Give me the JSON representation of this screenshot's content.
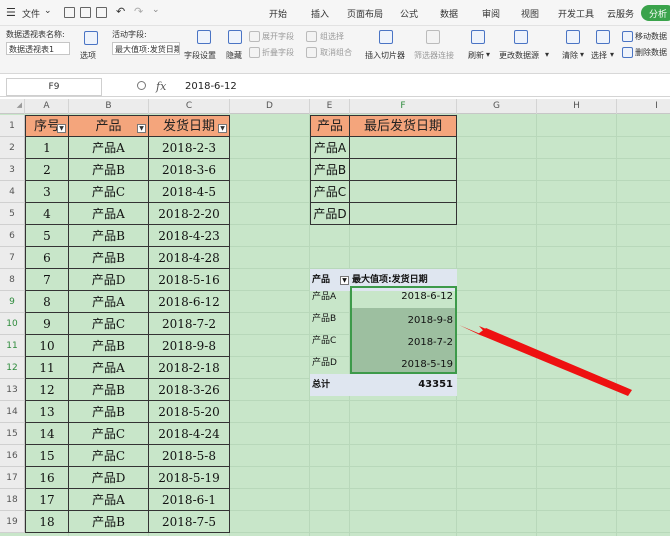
{
  "menubar": {
    "file_label": "文件",
    "tabs": [
      "开始",
      "插入",
      "页面布局",
      "公式",
      "数据",
      "审阅",
      "视图",
      "开发工具",
      "云服务"
    ],
    "pill_label": "分析"
  },
  "ribbon": {
    "pivot_name_label": "数据透视表名称:",
    "pivot_name_value": "数据透视表1",
    "options_label": "选项",
    "active_field_label": "活动字段:",
    "active_field_value": "最大值项:发货日期",
    "field_settings_label": "字段设置",
    "hide_label": "隐藏",
    "expand_label": "展开字段",
    "collapse_label": "折叠字段",
    "group_sel_label": "组选择",
    "ungroup_label": "取消组合",
    "insert_slicer_label": "插入切片器",
    "filter_conn_label": "筛选器连接",
    "refresh_label": "刷新",
    "change_source_label": "更改数据源",
    "clear_label": "清除",
    "select_label": "选择",
    "move_pivot_label": "移动数据",
    "delete_pivot_label": "删除数据"
  },
  "formula_bar": {
    "cell_ref": "F9",
    "fx": "fx",
    "value": "2018-6-12"
  },
  "columns": [
    "A",
    "B",
    "C",
    "D",
    "E",
    "F",
    "G",
    "H",
    "I"
  ],
  "rows": [
    "1",
    "2",
    "3",
    "4",
    "5",
    "6",
    "7",
    "8",
    "9",
    "10",
    "11",
    "12",
    "13",
    "14",
    "15",
    "16",
    "17",
    "18",
    "19"
  ],
  "main_table": {
    "headers": [
      "序号",
      "产品",
      "发货日期"
    ],
    "data": [
      [
        "1",
        "产品A",
        "2018-2-3"
      ],
      [
        "2",
        "产品B",
        "2018-3-6"
      ],
      [
        "3",
        "产品C",
        "2018-4-5"
      ],
      [
        "4",
        "产品A",
        "2018-2-20"
      ],
      [
        "5",
        "产品B",
        "2018-4-23"
      ],
      [
        "6",
        "产品B",
        "2018-4-28"
      ],
      [
        "7",
        "产品D",
        "2018-5-16"
      ],
      [
        "8",
        "产品A",
        "2018-6-12"
      ],
      [
        "9",
        "产品C",
        "2018-7-2"
      ],
      [
        "10",
        "产品B",
        "2018-9-8"
      ],
      [
        "11",
        "产品A",
        "2018-2-18"
      ],
      [
        "12",
        "产品B",
        "2018-3-26"
      ],
      [
        "13",
        "产品B",
        "2018-5-20"
      ],
      [
        "14",
        "产品C",
        "2018-4-24"
      ],
      [
        "15",
        "产品C",
        "2018-5-8"
      ],
      [
        "16",
        "产品D",
        "2018-5-19"
      ],
      [
        "17",
        "产品A",
        "2018-6-1"
      ],
      [
        "18",
        "产品B",
        "2018-7-5"
      ]
    ]
  },
  "summary_table": {
    "headers": [
      "产品",
      "最后发货日期"
    ],
    "products": [
      "产品A",
      "产品B",
      "产品C",
      "产品D"
    ]
  },
  "pivot": {
    "row_header": "产品",
    "value_header": "最大值项:发货日期",
    "rows": [
      [
        "产品A",
        "2018-6-12"
      ],
      [
        "产品B",
        "2018-9-8"
      ],
      [
        "产品C",
        "2018-7-2"
      ],
      [
        "产品D",
        "2018-5-19"
      ]
    ],
    "total_label": "总计",
    "total_value": "43351"
  },
  "colors": {
    "header_fill": "#f4a57c",
    "sheet_bg": "#c8e6c9",
    "selection": "#3d9a4a",
    "arrow": "#ee1111"
  }
}
